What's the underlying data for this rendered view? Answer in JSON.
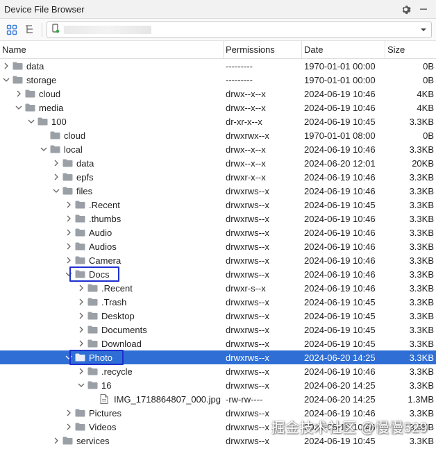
{
  "window": {
    "title": "Device File Browser"
  },
  "columns": {
    "name": "Name",
    "permissions": "Permissions",
    "date": "Date",
    "size": "Size"
  },
  "rows": [
    {
      "name": "data",
      "perm": "---------",
      "date": "1970-01-01 00:00",
      "size": "0B",
      "depth": 0,
      "chevron": "right",
      "icon": "folder-icon"
    },
    {
      "name": "storage",
      "perm": "---------",
      "date": "1970-01-01 00:00",
      "size": "0B",
      "depth": 0,
      "chevron": "down",
      "icon": "folder-icon"
    },
    {
      "name": "cloud",
      "perm": "drwx--x--x",
      "date": "2024-06-19 10:46",
      "size": "4KB",
      "depth": 1,
      "chevron": "right",
      "icon": "folder-icon"
    },
    {
      "name": "media",
      "perm": "drwx--x--x",
      "date": "2024-06-19 10:46",
      "size": "4KB",
      "depth": 1,
      "chevron": "down",
      "icon": "folder-icon"
    },
    {
      "name": "100",
      "perm": "dr-xr-x--x",
      "date": "2024-06-19 10:45",
      "size": "3.3KB",
      "depth": 2,
      "chevron": "down",
      "icon": "folder-icon"
    },
    {
      "name": "cloud",
      "perm": "drwxrwx--x",
      "date": "1970-01-01 08:00",
      "size": "0B",
      "depth": 3,
      "chevron": "none",
      "icon": "folder-icon"
    },
    {
      "name": "local",
      "perm": "drwx--x--x",
      "date": "2024-06-19 10:46",
      "size": "3.3KB",
      "depth": 3,
      "chevron": "down",
      "icon": "folder-icon"
    },
    {
      "name": "data",
      "perm": "drwx--x--x",
      "date": "2024-06-20 12:01",
      "size": "20KB",
      "depth": 4,
      "chevron": "right",
      "icon": "folder-icon"
    },
    {
      "name": "epfs",
      "perm": "drwxr-x--x",
      "date": "2024-06-19 10:46",
      "size": "3.3KB",
      "depth": 4,
      "chevron": "right",
      "icon": "folder-icon"
    },
    {
      "name": "files",
      "perm": "drwxrws--x",
      "date": "2024-06-19 10:46",
      "size": "3.3KB",
      "depth": 4,
      "chevron": "down",
      "icon": "folder-icon"
    },
    {
      "name": ".Recent",
      "perm": "drwxrws--x",
      "date": "2024-06-19 10:45",
      "size": "3.3KB",
      "depth": 5,
      "chevron": "right",
      "icon": "folder-icon"
    },
    {
      "name": ".thumbs",
      "perm": "drwxrws--x",
      "date": "2024-06-19 10:46",
      "size": "3.3KB",
      "depth": 5,
      "chevron": "right",
      "icon": "folder-icon"
    },
    {
      "name": "Audio",
      "perm": "drwxrws--x",
      "date": "2024-06-19 10:46",
      "size": "3.3KB",
      "depth": 5,
      "chevron": "right",
      "icon": "folder-icon"
    },
    {
      "name": "Audios",
      "perm": "drwxrws--x",
      "date": "2024-06-19 10:46",
      "size": "3.3KB",
      "depth": 5,
      "chevron": "right",
      "icon": "folder-icon"
    },
    {
      "name": "Camera",
      "perm": "drwxrws--x",
      "date": "2024-06-19 10:46",
      "size": "3.3KB",
      "depth": 5,
      "chevron": "right",
      "icon": "folder-icon"
    },
    {
      "name": "Docs",
      "perm": "drwxrws--x",
      "date": "2024-06-19 10:46",
      "size": "3.3KB",
      "depth": 5,
      "chevron": "down",
      "icon": "folder-icon",
      "boxed": true
    },
    {
      "name": ".Recent",
      "perm": "drwxr-s--x",
      "date": "2024-06-19 10:46",
      "size": "3.3KB",
      "depth": 6,
      "chevron": "right",
      "icon": "folder-icon"
    },
    {
      "name": ".Trash",
      "perm": "drwxrws--x",
      "date": "2024-06-19 10:45",
      "size": "3.3KB",
      "depth": 6,
      "chevron": "right",
      "icon": "folder-icon"
    },
    {
      "name": "Desktop",
      "perm": "drwxrws--x",
      "date": "2024-06-19 10:45",
      "size": "3.3KB",
      "depth": 6,
      "chevron": "right",
      "icon": "folder-icon"
    },
    {
      "name": "Documents",
      "perm": "drwxrws--x",
      "date": "2024-06-19 10:45",
      "size": "3.3KB",
      "depth": 6,
      "chevron": "right",
      "icon": "folder-icon"
    },
    {
      "name": "Download",
      "perm": "drwxrws--x",
      "date": "2024-06-19 10:45",
      "size": "3.3KB",
      "depth": 6,
      "chevron": "right",
      "icon": "folder-icon"
    },
    {
      "name": "Photo",
      "perm": "drwxrws--x",
      "date": "2024-06-20 14:25",
      "size": "3.3KB",
      "depth": 5,
      "chevron": "down",
      "icon": "folder-icon",
      "selected": true,
      "boxed": true
    },
    {
      "name": ".recycle",
      "perm": "drwxrws--x",
      "date": "2024-06-19 10:46",
      "size": "3.3KB",
      "depth": 6,
      "chevron": "right",
      "icon": "folder-icon"
    },
    {
      "name": "16",
      "perm": "drwxrws--x",
      "date": "2024-06-20 14:25",
      "size": "3.3KB",
      "depth": 6,
      "chevron": "down",
      "icon": "folder-icon"
    },
    {
      "name": "IMG_1718864807_000.jpg",
      "perm": "-rw-rw----",
      "date": "2024-06-20 14:25",
      "size": "1.3MB",
      "depth": 7,
      "chevron": "none",
      "icon": "file-icon"
    },
    {
      "name": "Pictures",
      "perm": "drwxrws--x",
      "date": "2024-06-19 10:46",
      "size": "3.3KB",
      "depth": 5,
      "chevron": "right",
      "icon": "folder-icon"
    },
    {
      "name": "Videos",
      "perm": "drwxrws--x",
      "date": "2024-06-19 10:46",
      "size": "3.3KB",
      "depth": 5,
      "chevron": "right",
      "icon": "folder-icon"
    },
    {
      "name": "services",
      "perm": "drwxrws--x",
      "date": "2024-06-19 10:45",
      "size": "3.3KB",
      "depth": 4,
      "chevron": "right",
      "icon": "folder-icon"
    }
  ],
  "watermark": "掘金技术社区 @慢慢529",
  "colors": {
    "selection": "#2f6fd5",
    "folder": "#9aa0a6",
    "highlight_box": "#1f2fd0",
    "device_status": "#3aa845"
  }
}
